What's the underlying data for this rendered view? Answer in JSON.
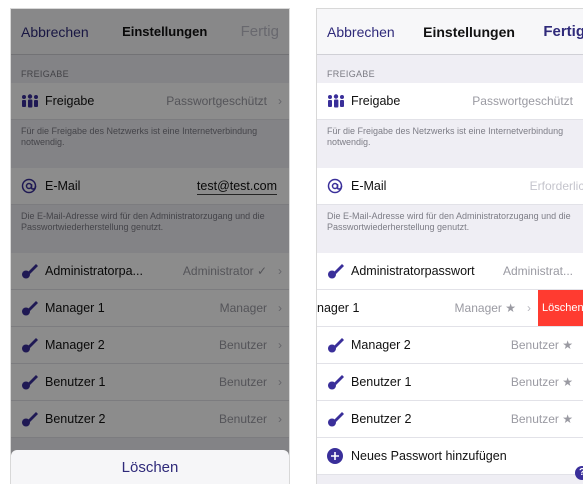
{
  "nav": {
    "cancel": "Abbrechen",
    "title": "Einstellungen",
    "done": "Fertig"
  },
  "section": {
    "title": "FREIGABE"
  },
  "sharing": {
    "label": "Freigabe",
    "value": "Passwortgeschützt",
    "note": "Für die Freigabe des Netzwerks ist eine Internetverbindung notwendig."
  },
  "email": {
    "label": "E-Mail",
    "left_value": "test@test.com",
    "right_placeholder": "Erforderlich",
    "note": "Die E-Mail-Adresse wird für den Administratorzugang und die Passwortwiederherstellung genutzt."
  },
  "left_rows": [
    {
      "label": "Administratorpa...",
      "value": "Administrator ✓"
    },
    {
      "label": "Manager 1",
      "value": "Manager"
    },
    {
      "label": "Manager 2",
      "value": "Benutzer"
    },
    {
      "label": "Benutzer 1",
      "value": "Benutzer"
    },
    {
      "label": "Benutzer 2",
      "value": "Benutzer"
    }
  ],
  "sheet": {
    "delete_label": "Löschen"
  },
  "right_rows": {
    "admin": {
      "label": "Administratorpasswort",
      "value": "Administrat..."
    },
    "swiped": {
      "label": "nager 1",
      "value": "Manager ★",
      "delete": "Löschen"
    },
    "manager2": {
      "label": "Manager 2",
      "value": "Benutzer ★"
    },
    "user1": {
      "label": "Benutzer 1",
      "value": "Benutzer ★"
    },
    "user2": {
      "label": "Benutzer 2",
      "value": "Benutzer ★"
    },
    "add": {
      "label": "Neues Passwort hinzufügen"
    }
  },
  "colors": {
    "accent": "#2f2a7a",
    "icon": "#3a2f9a",
    "delete": "#ff3b30"
  },
  "icons": {
    "people": "people-icon",
    "at": "at-icon",
    "key": "key-icon",
    "add": "plus-circle-icon",
    "help": "help-icon"
  },
  "glyphs": {
    "chevron": "›",
    "help": "?"
  }
}
